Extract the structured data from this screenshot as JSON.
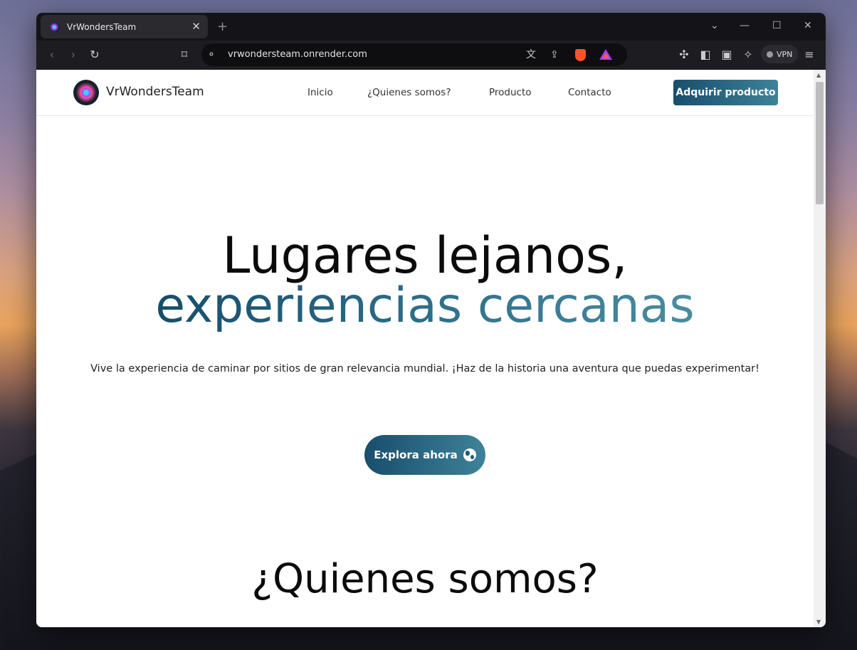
{
  "browser": {
    "tab_title": "VrWondersTeam",
    "tab_close": "✕",
    "new_tab": "+",
    "url": "vrwondersteam.onrender.com",
    "vpn_label": "VPN"
  },
  "nav": {
    "brand": "VrWondersTeam",
    "links": [
      "Inicio",
      "¿Quienes somos?",
      "Producto",
      "Contacto"
    ],
    "cta": "Adquirir producto"
  },
  "hero": {
    "line1": "Lugares lejanos,",
    "line2": "experiencias cercanas",
    "subtitle": "Vive la experiencia de caminar por sitios de gran relevancia mundial. ¡Haz de la historia una aventura que puedas experimentar!",
    "button": "Explora ahora"
  },
  "section": {
    "title": "¿Quienes somos?"
  },
  "colors": {
    "accent_dark": "#184e6c",
    "accent_light": "#3e8299"
  },
  "icons": [
    "favicon-icon",
    "close-icon",
    "plus-icon",
    "chevron-down-icon",
    "minimize-icon",
    "maximize-icon",
    "window-close-icon",
    "back-icon",
    "forward-icon",
    "reload-icon",
    "bookmark-icon",
    "site-info-icon",
    "translate-icon",
    "share-icon",
    "brave-shields-icon",
    "brave-rewards-icon",
    "extensions-icon",
    "sidebar-icon",
    "wallet-icon",
    "leo-ai-icon",
    "menu-icon",
    "globe-icon"
  ]
}
